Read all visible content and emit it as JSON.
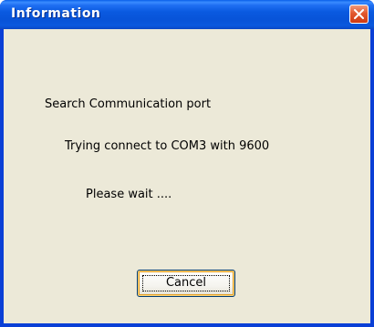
{
  "window": {
    "title": "Information",
    "close_icon": "close-icon"
  },
  "messages": {
    "line1": "Search Communication port",
    "line2": "Trying connect to COM3 with 9600",
    "line3": "Please wait ...."
  },
  "buttons": {
    "cancel_label": "Cancel"
  },
  "colors": {
    "titlebar": "#0a5ae0",
    "client_background": "#ece9d8",
    "close_button": "#e2582f"
  }
}
